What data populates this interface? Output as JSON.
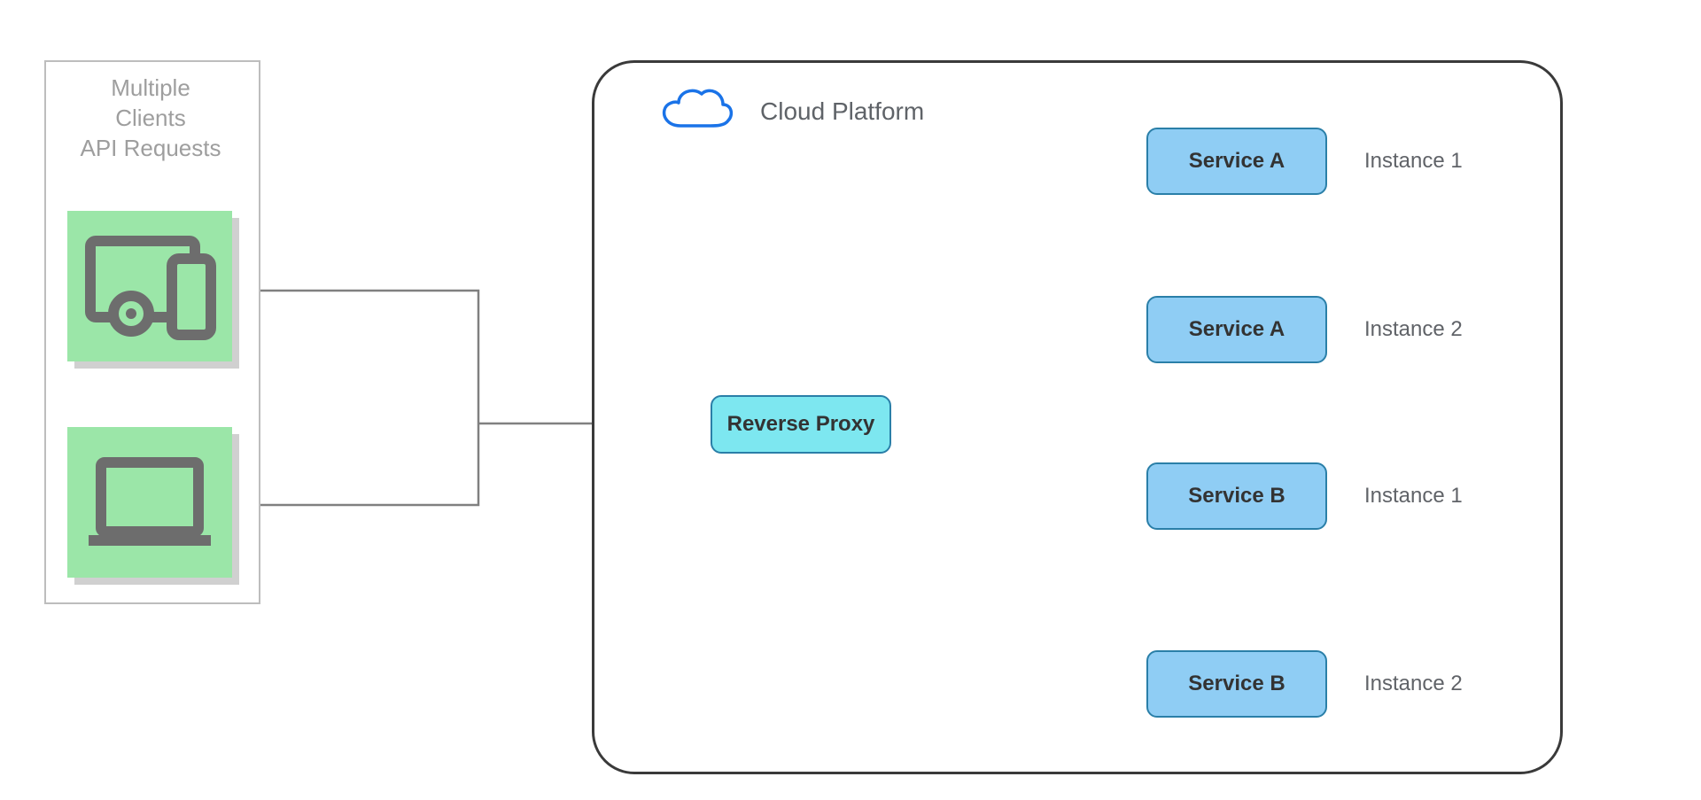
{
  "clients": {
    "title_line1": "Multiple",
    "title_line2": "Clients",
    "title_line3": "API Requests"
  },
  "cloud": {
    "label": "Cloud Platform"
  },
  "proxy": {
    "label": "Reverse Proxy"
  },
  "services": [
    {
      "label": "Service A",
      "instance": "Instance 1"
    },
    {
      "label": "Service A",
      "instance": "Instance 2"
    },
    {
      "label": "Service B",
      "instance": "Instance 1"
    },
    {
      "label": "Service B",
      "instance": "Instance 2"
    }
  ],
  "colors": {
    "clientTile": "#9be6a8",
    "proxyFill": "#7de7f0",
    "serviceFill": "#8fcdf4",
    "nodeBorder": "#2a7fa8",
    "cloudStroke": "#1a73e8",
    "frameStroke": "#3a3a3a",
    "frameStrokeLight": "#bdbdbd",
    "edge": "#808080"
  },
  "diagram": {
    "type": "architecture",
    "nodes": [
      {
        "id": "clients",
        "label": "Multiple Clients API Requests"
      },
      {
        "id": "proxy",
        "label": "Reverse Proxy"
      },
      {
        "id": "svcA1",
        "label": "Service A",
        "instance": "Instance 1"
      },
      {
        "id": "svcA2",
        "label": "Service A",
        "instance": "Instance 2"
      },
      {
        "id": "svcB1",
        "label": "Service B",
        "instance": "Instance 1"
      },
      {
        "id": "svcB2",
        "label": "Service B",
        "instance": "Instance 2"
      }
    ],
    "edges": [
      {
        "from": "clients",
        "to": "proxy"
      },
      {
        "from": "proxy",
        "to": "svcA1"
      },
      {
        "from": "proxy",
        "to": "svcA2"
      },
      {
        "from": "proxy",
        "to": "svcB1"
      },
      {
        "from": "proxy",
        "to": "svcB2"
      }
    ],
    "container": {
      "id": "cloud",
      "label": "Cloud Platform",
      "contains": [
        "proxy",
        "svcA1",
        "svcA2",
        "svcB1",
        "svcB2"
      ]
    }
  }
}
